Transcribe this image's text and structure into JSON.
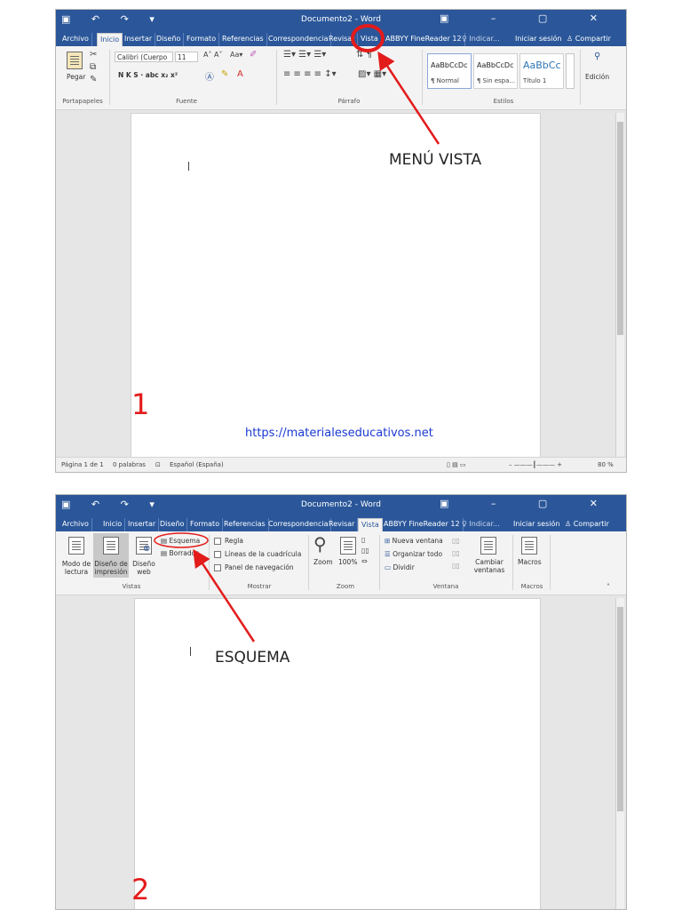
{
  "colors": {
    "word_blue": "#2b579a",
    "annotation_red": "#e31b1b",
    "link_blue": "#1a3ad1"
  },
  "shot1": {
    "title": "Documento2 - Word",
    "tabs": [
      "Archivo",
      "Inicio",
      "Insertar",
      "Diseño",
      "Formato",
      "Referencias",
      "Correspondencia",
      "Revisar",
      "Vista",
      "ABBYY FineReader 12",
      "Indicar...",
      "Iniciar sesión",
      "Compartir"
    ],
    "groups": {
      "clipboard": "Portapapeles",
      "font": "Fuente",
      "paragraph": "Párrafo",
      "styles": "Estilos"
    },
    "paste_label": "Pegar",
    "font_name": "Calibri (Cuerpo",
    "font_size": "11",
    "font_format": "N  K  S  ·  abc  x₂  x²",
    "styles": [
      {
        "preview": "AaBbCcDc",
        "name": "¶ Normal"
      },
      {
        "preview": "AaBbCcDc",
        "name": "¶ Sin espa..."
      },
      {
        "preview": "AaBbCc",
        "name": "Título 1"
      }
    ],
    "edit_label": "Edición",
    "status": {
      "page": "Página 1 de 1",
      "words": "0 palabras",
      "language": "Español (España)",
      "zoom": "80 %"
    },
    "annotation": "MENÚ VISTA",
    "step": "1",
    "link": "https://materialeseducativos.net"
  },
  "shot2": {
    "title": "Documento2 - Word",
    "tabs": [
      "Archivo",
      "Inicio",
      "Insertar",
      "Diseño",
      "Formato",
      "Referencias",
      "Correspondencia",
      "Revisar",
      "Vista",
      "ABBYY FineReader 12",
      "Indicar...",
      "Iniciar sesión",
      "Compartir"
    ],
    "views": {
      "read_mode": "Modo de lectura",
      "print_layout": "Diseño de impresión",
      "web_layout": "Diseño web",
      "outline": "Esquema",
      "draft": "Borrador"
    },
    "show": {
      "ruler": "Regla",
      "gridlines": "Líneas de la cuadrícula",
      "nav_pane": "Panel de navegación"
    },
    "zoom": {
      "zoom": "Zoom",
      "percent": "100%"
    },
    "window": {
      "new": "Nueva ventana",
      "arrange": "Organizar todo",
      "split": "Dividir",
      "switch": "Cambiar ventanas"
    },
    "macros_label": "Macros",
    "groups": {
      "views": "Vistas",
      "show": "Mostrar",
      "zoom": "Zoom",
      "window": "Ventana",
      "macros": "Macros"
    },
    "annotation": "ESQUEMA",
    "step": "2"
  }
}
